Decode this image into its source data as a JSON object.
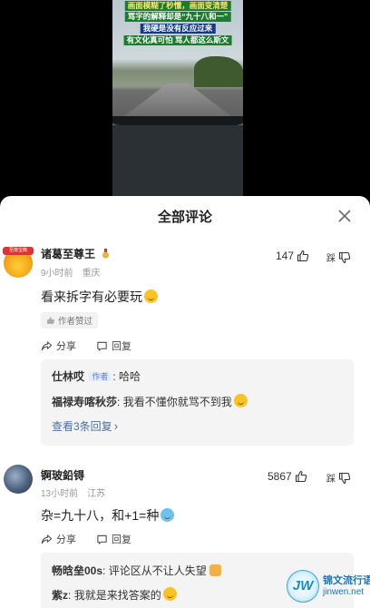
{
  "video": {
    "captions": [
      "画面模糊了秒懂，画面变清楚",
      "骂字的解释却是“九十八和一”",
      "我硬是没有反应过来",
      "有文化真可怕 骂人都这么斯文"
    ]
  },
  "sheet": {
    "title": "全部评论",
    "close_icon": "close-icon"
  },
  "comments": [
    {
      "username": "诸葛至尊王",
      "avatar_badge": "至尊宝典",
      "time": "9小时前",
      "location": "重庆",
      "text": "看来拆字有必要玩",
      "likes": "147",
      "dislike_label": "踩",
      "author_liked": "作者赞过",
      "actions": {
        "share": "分享",
        "reply": "回复"
      },
      "replies": [
        {
          "name": "仕林哎",
          "tag": "作者",
          "text": "哈哈"
        },
        {
          "name": "福禄寿喀秋莎",
          "tag": "",
          "text": "我看不懂你就骂不到我"
        }
      ],
      "more_replies": "查看3条回复"
    },
    {
      "username": "锕玻鉛锝",
      "time": "13小时前",
      "location": "江苏",
      "text": "杂=九十八，和+1=种",
      "likes": "5867",
      "dislike_label": "踩",
      "actions": {
        "share": "分享",
        "reply": "回复"
      },
      "replies": [
        {
          "name": "畅晗垒00s",
          "tag": "",
          "text": "评论区从不让人失望"
        },
        {
          "name": "紫z",
          "tag": "",
          "text": "我就是来找答案的"
        }
      ]
    }
  ],
  "watermark": {
    "logo": "JW",
    "name": "锦文流行语",
    "url": "jinwen.net"
  },
  "colors": {
    "link": "#4a6fa5",
    "tag": "#5a7fd6",
    "sheet_bg": "#ffffff",
    "reply_bg": "#f4f4f5"
  }
}
